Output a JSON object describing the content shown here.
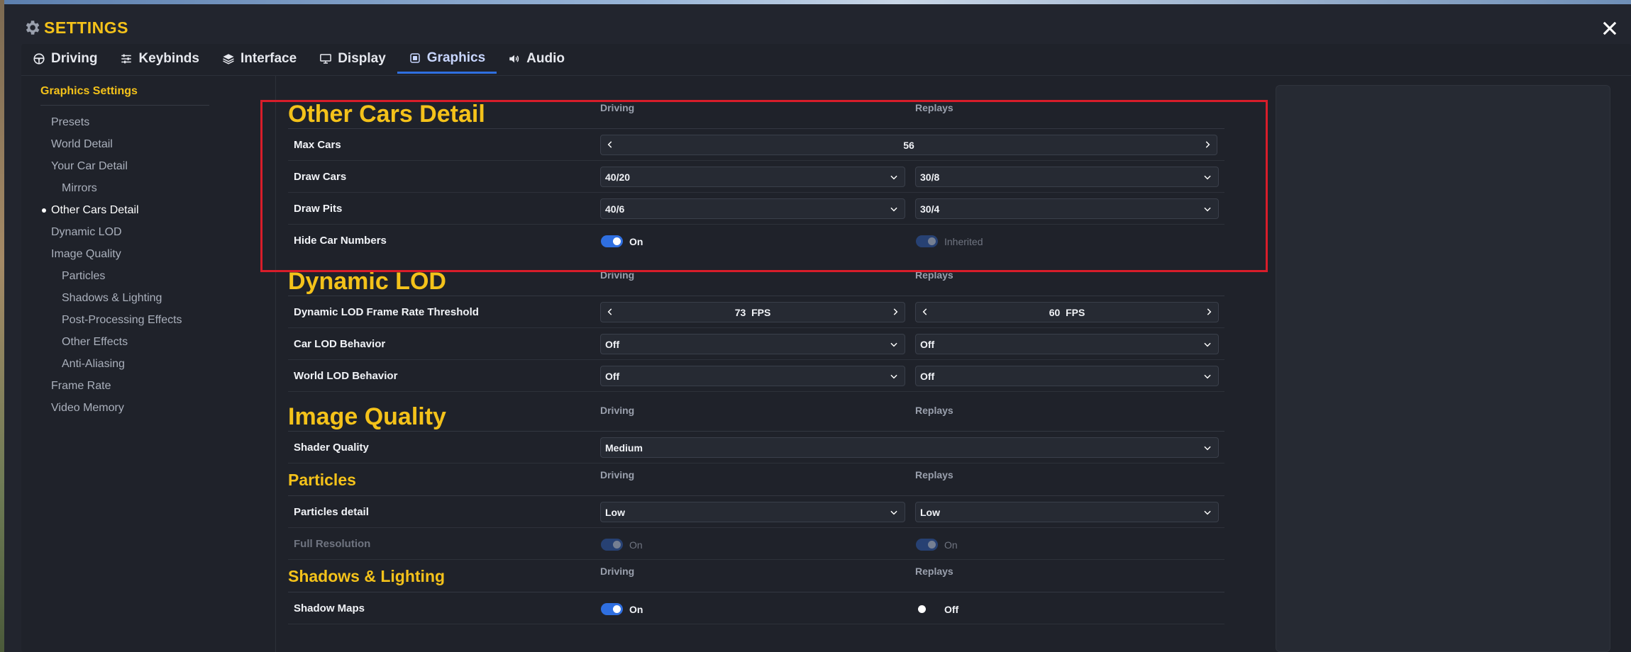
{
  "window": {
    "title": "SETTINGS"
  },
  "tabs": [
    {
      "label": "Driving",
      "icon": "steering-wheel-icon"
    },
    {
      "label": "Keybinds",
      "icon": "sliders-icon"
    },
    {
      "label": "Interface",
      "icon": "layers-icon"
    },
    {
      "label": "Display",
      "icon": "monitor-icon"
    },
    {
      "label": "Graphics",
      "icon": "chip-icon",
      "active": true
    },
    {
      "label": "Audio",
      "icon": "speaker-icon"
    }
  ],
  "sidebar": {
    "heading": "Graphics Settings",
    "items": [
      {
        "label": "Presets"
      },
      {
        "label": "World Detail"
      },
      {
        "label": "Your Car Detail"
      },
      {
        "label": "Mirrors",
        "sub": true
      },
      {
        "label": "Other Cars Detail",
        "active": true
      },
      {
        "label": "Dynamic LOD"
      },
      {
        "label": "Image Quality"
      },
      {
        "label": "Particles",
        "sub": true
      },
      {
        "label": "Shadows & Lighting",
        "sub": true
      },
      {
        "label": "Post-Processing Effects",
        "sub": true
      },
      {
        "label": "Other Effects",
        "sub": true
      },
      {
        "label": "Anti-Aliasing",
        "sub": true
      },
      {
        "label": "Frame Rate"
      },
      {
        "label": "Video Memory"
      }
    ]
  },
  "columns": {
    "driving": "Driving",
    "replays": "Replays"
  },
  "other_cars": {
    "title": "Other Cars Detail",
    "max_cars": {
      "label": "Max Cars",
      "value": "56"
    },
    "draw_cars": {
      "label": "Draw Cars",
      "driving": "40/20",
      "replays": "30/8"
    },
    "draw_pits": {
      "label": "Draw Pits",
      "driving": "40/6",
      "replays": "30/4"
    },
    "hide_numbers": {
      "label": "Hide Car Numbers",
      "driving": "On",
      "replays": "Inherited"
    }
  },
  "dynamic_lod": {
    "title": "Dynamic LOD",
    "threshold": {
      "label": "Dynamic LOD Frame Rate Threshold",
      "driving": "73",
      "replays": "60",
      "unit": "FPS"
    },
    "car_lod": {
      "label": "Car LOD Behavior",
      "driving": "Off",
      "replays": "Off"
    },
    "world_lod": {
      "label": "World LOD Behavior",
      "driving": "Off",
      "replays": "Off"
    }
  },
  "image_quality": {
    "title": "Image Quality",
    "shader": {
      "label": "Shader Quality",
      "value": "Medium"
    }
  },
  "particles": {
    "title": "Particles",
    "detail": {
      "label": "Particles detail",
      "driving": "Low",
      "replays": "Low"
    },
    "full_res": {
      "label": "Full Resolution",
      "driving": "On",
      "replays": "On"
    }
  },
  "shadows": {
    "title": "Shadows & Lighting",
    "shadow_maps": {
      "label": "Shadow Maps",
      "driving": "On",
      "replays": "Off"
    }
  },
  "colors": {
    "accent": "#f4c21a",
    "toggle": "#2f6fe0",
    "highlight": "#d81d2a"
  }
}
